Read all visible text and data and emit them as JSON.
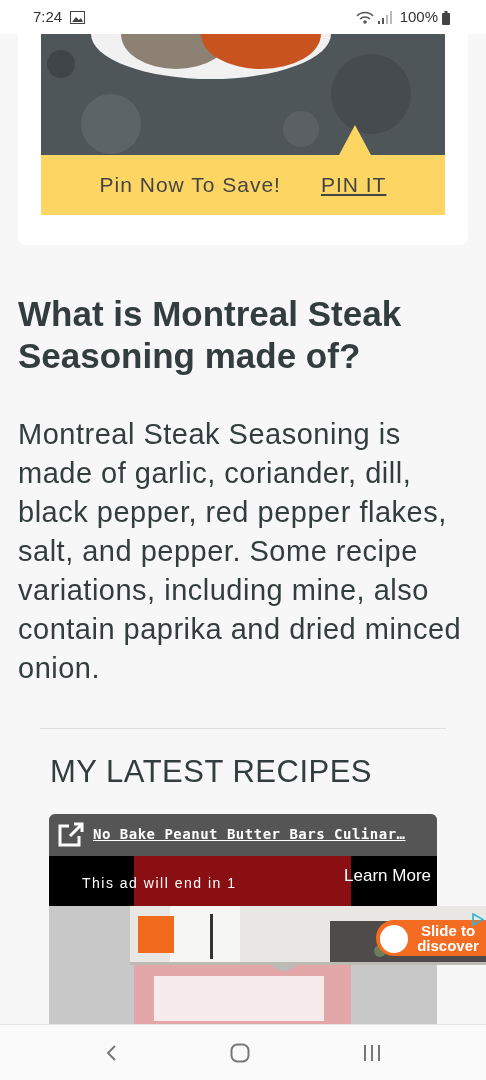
{
  "status_bar": {
    "time": "7:24",
    "battery": "100%"
  },
  "pin_card": {
    "prompt": "Pin Now To Save!",
    "link": "PIN IT"
  },
  "article": {
    "heading": "What is Montreal Steak Seasoning made of?",
    "paragraph": "Montreal Steak Seasoning is made of garlic, coriander, dill, black pepper, red pepper flakes, salt, and pepper. Some recipe variations, including mine, also contain paprika and dried minced onion."
  },
  "latest": {
    "title": "MY LATEST RECIPES"
  },
  "video_ad": {
    "title": "No Bake Peanut Butter Bars Culinar…",
    "countdown": "This ad will end in 1",
    "cta": "Learn More"
  },
  "banner_ad": {
    "cta": "Slide to discover"
  }
}
